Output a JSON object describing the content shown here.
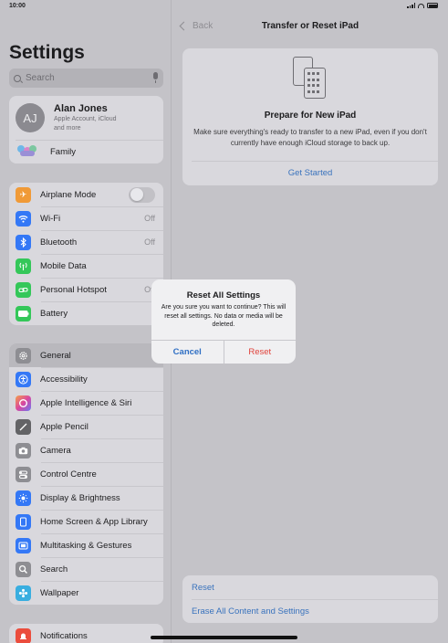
{
  "status": {
    "time": "10:00"
  },
  "sidebar": {
    "title": "Settings",
    "search_placeholder": "Search",
    "profile": {
      "initials": "AJ",
      "name": "Alan Jones",
      "subtitle_1": "Apple Account, iCloud",
      "subtitle_2": "and more"
    },
    "family_label": "Family",
    "connectivity": [
      {
        "label": "Airplane Mode",
        "color": "#f09a37"
      },
      {
        "label": "Wi-Fi",
        "value": "Off",
        "color": "#3478f6"
      },
      {
        "label": "Bluetooth",
        "value": "Off",
        "color": "#3478f6"
      },
      {
        "label": "Mobile Data",
        "color": "#34c759"
      },
      {
        "label": "Personal Hotspot",
        "value": "Off",
        "color": "#34c759"
      },
      {
        "label": "Battery",
        "color": "#34c759"
      }
    ],
    "general": [
      {
        "label": "General",
        "color": "#8e8e93"
      },
      {
        "label": "Accessibility",
        "color": "#3478f6"
      },
      {
        "label": "Apple Intelligence & Siri",
        "color": "#c86bd6"
      },
      {
        "label": "Apple Pencil",
        "color": "#636366"
      },
      {
        "label": "Camera",
        "color": "#8e8e93"
      },
      {
        "label": "Control Centre",
        "color": "#8e8e93"
      },
      {
        "label": "Display & Brightness",
        "color": "#3478f6"
      },
      {
        "label": "Home Screen & App Library",
        "color": "#3478f6"
      },
      {
        "label": "Multitasking & Gestures",
        "color": "#3478f6"
      },
      {
        "label": "Search",
        "color": "#8e8e93"
      },
      {
        "label": "Wallpaper",
        "color": "#39aee0"
      }
    ],
    "notifications": {
      "label": "Notifications",
      "color": "#eb4d3d"
    }
  },
  "detail": {
    "back_label": "Back",
    "title": "Transfer or Reset iPad",
    "card": {
      "title": "Prepare for New iPad",
      "description": "Make sure everything's ready to transfer to a new iPad, even if you don't currently have enough iCloud storage to back up.",
      "action": "Get Started"
    },
    "bottom": {
      "reset": "Reset",
      "erase": "Erase All Content and Settings"
    }
  },
  "alert": {
    "title": "Reset All Settings",
    "message": "Are you sure you want to continue? This will reset all settings. No data or media will be deleted.",
    "cancel": "Cancel",
    "confirm": "Reset"
  }
}
